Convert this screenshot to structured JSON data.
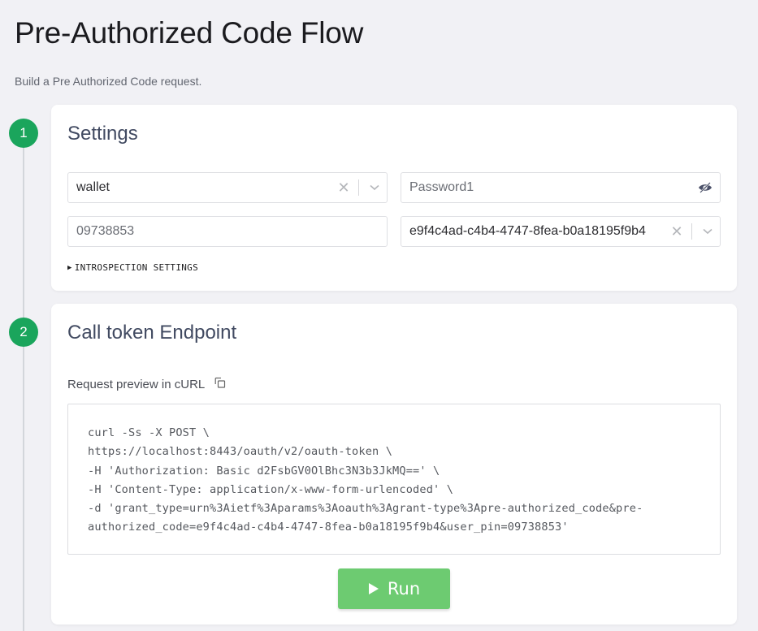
{
  "header": {
    "title": "Pre-Authorized Code Flow",
    "subtitle": "Build a Pre Authorized Code request."
  },
  "colors": {
    "step_badge": "#1aa55c",
    "run_button": "#6dcb71",
    "card_title": "#414a61"
  },
  "steps": [
    {
      "number": "1",
      "title": "Settings",
      "fields": {
        "client_select": {
          "value": "wallet",
          "icons": [
            "clear-icon",
            "chevron-down-icon"
          ]
        },
        "password": {
          "value": "Password1",
          "icon": "eye-slash-icon"
        },
        "user_pin": {
          "value": "09738853"
        },
        "code_select": {
          "value": "e9f4c4ad-c4b4-4747-8fea-b0a18195f9b4",
          "icons": [
            "clear-icon",
            "chevron-down-icon"
          ]
        }
      },
      "disclosure": {
        "icon": "triangle-right-icon",
        "label": "INTROSPECTION SETTINGS"
      }
    },
    {
      "number": "2",
      "title": "Call token Endpoint",
      "request_label": "Request preview in cURL",
      "copy_icon": "copy-icon",
      "curl_lines": [
        "curl -Ss -X POST \\",
        "https://localhost:8443/oauth/v2/oauth-token \\",
        "-H 'Authorization: Basic d2FsbGV0OlBhc3N3b3JkMQ==' \\",
        "-H 'Content-Type: application/x-www-form-urlencoded' \\",
        "-d 'grant_type=urn%3Aietf%3Aparams%3Aoauth%3Agrant-type%3Apre-authorized_code&pre-",
        "authorized_code=e9f4c4ad-c4b4-4747-8fea-b0a18195f9b4&user_pin=09738853'"
      ],
      "run_button": {
        "icon": "play-icon",
        "label": "Run"
      }
    }
  ]
}
